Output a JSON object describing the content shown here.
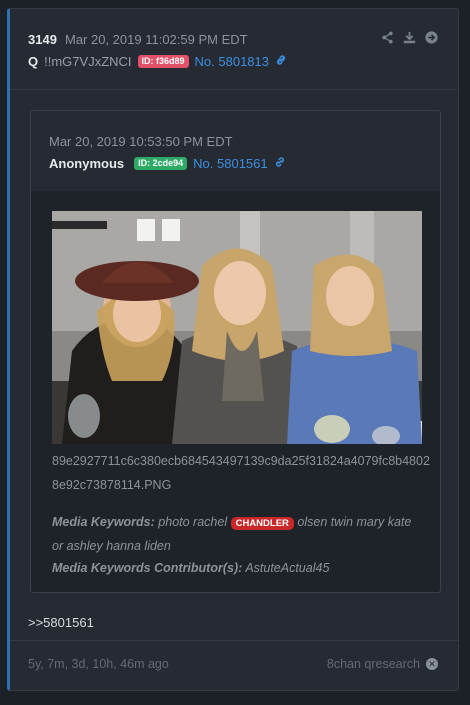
{
  "post": {
    "number": "3149",
    "date": "Mar 20, 2019 11:02:59 PM EDT",
    "name": "Q",
    "tripcode": "!!mG7VJxZNCI",
    "id_label": "ID: f36d89",
    "id_color": "#e2506a",
    "no_label": "No. 5801813",
    "icons": [
      "share-icon",
      "download-icon",
      "arrow-right-circle-icon"
    ]
  },
  "quote": {
    "date": "Mar 20, 2019 10:53:50 PM EDT",
    "name": "Anonymous",
    "id_label": "ID: 2cde94",
    "id_color": "#2eaa66",
    "no_label": "No. 5801561",
    "filename": "89e2927711c6c380ecb684543497139c9da25f31824a4079fc8b48028e92c73878114.PNG",
    "keywords_label": "Media Keywords:",
    "keywords_before": "photo rachel",
    "keywords_tag": "CHANDLER",
    "keywords_after": "olsen twin mary kate or ashley hanna liden",
    "contributor_label": "Media Keywords Contributor(s):",
    "contributor": "AstuteActual45"
  },
  "reply_ref": ">>5801561",
  "footer": {
    "time_ago": "5y, 7m, 3d, 10h, 46m ago",
    "source": "8chan qresearch"
  }
}
